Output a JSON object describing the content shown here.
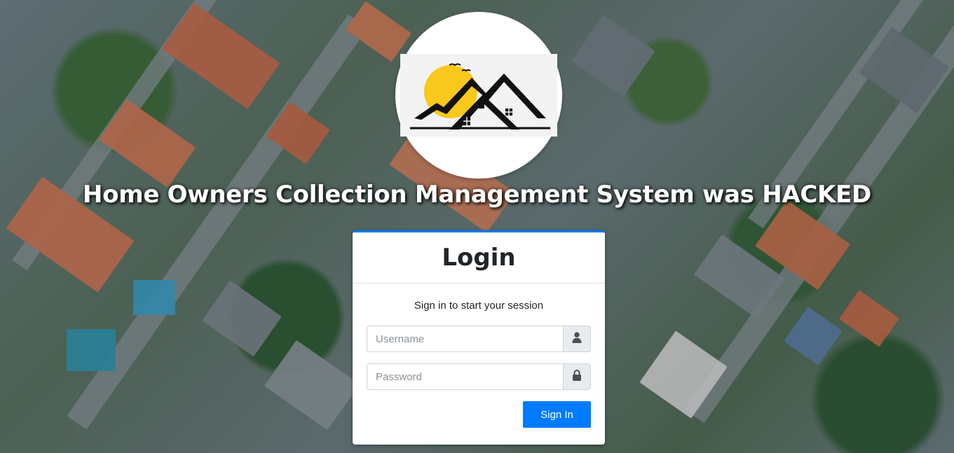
{
  "header": {
    "system_title": "Home Owners Collection Management System was HACKED",
    "logo_icon": "house-mountain-sun-logo"
  },
  "login": {
    "title": "Login",
    "message": "Sign in to start your session",
    "username": {
      "placeholder": "Username",
      "value": "",
      "icon": "user-icon"
    },
    "password": {
      "placeholder": "Password",
      "value": "",
      "icon": "lock-icon"
    },
    "submit_label": "Sign In"
  },
  "colors": {
    "primary": "#007bff",
    "logo_sun": "#f8c81c",
    "logo_ink": "#111111",
    "title_text": "#ffffff"
  }
}
